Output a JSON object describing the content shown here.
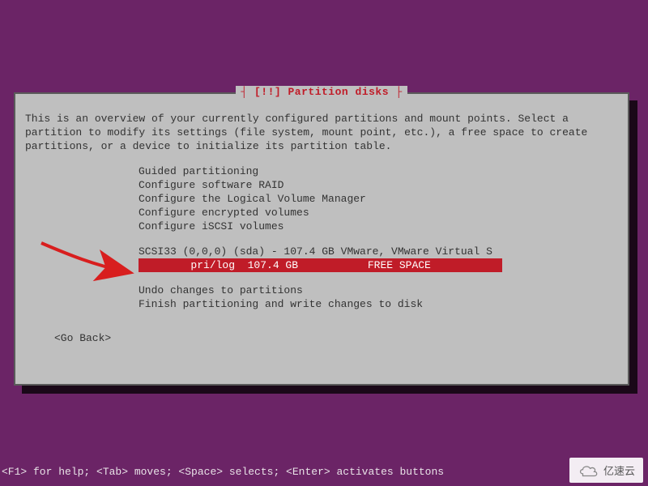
{
  "dialog": {
    "title_prefix": "[!!]",
    "title_text": "Partition disks",
    "intro": "This is an overview of your currently configured partitions and mount points. Select a partition to modify its settings (file system, mount point, etc.), a free space to create partitions, or a device to initialize its partition table."
  },
  "menu": {
    "items": [
      "Guided partitioning",
      "Configure software RAID",
      "Configure the Logical Volume Manager",
      "Configure encrypted volumes",
      "Configure iSCSI volumes"
    ]
  },
  "disk": {
    "header": "SCSI33 (0,0,0) (sda) - 107.4 GB VMware, VMware Virtual S",
    "selected_row": "        pri/log  107.4 GB           FREE SPACE           "
  },
  "post_menu": {
    "items": [
      "Undo changes to partitions",
      "Finish partitioning and write changes to disk"
    ]
  },
  "nav": {
    "go_back": "<Go Back>"
  },
  "footer": {
    "help": "<F1> for help; <Tab> moves; <Space> selects; <Enter> activates buttons"
  },
  "watermark": {
    "text": "亿速云"
  }
}
